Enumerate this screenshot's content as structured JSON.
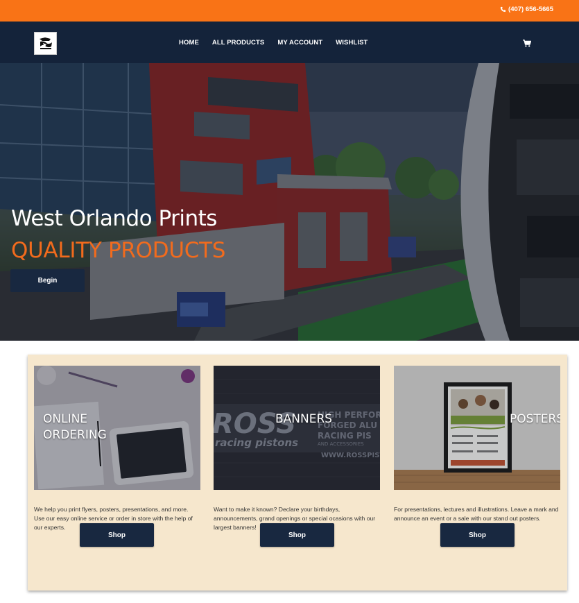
{
  "topbar": {
    "phone": "(407) 656-5665",
    "icon": "phone-icon"
  },
  "nav": {
    "items": [
      {
        "label": "HOME"
      },
      {
        "label": "ALL PRODUCTS"
      },
      {
        "label": "MY ACCOUNT"
      },
      {
        "label": "WISHLIST"
      }
    ],
    "cart_icon": "cart-icon"
  },
  "hero": {
    "title": "West Orlando Prints",
    "subtitle": "QUALITY PRODUCTS",
    "button": "Begin"
  },
  "products": [
    {
      "label_line1": "ONLINE",
      "label_line2": "ORDERING",
      "description": "We help you print flyers, posters, presentations, and more. Use our easy online service or order in store with the help of our experts.",
      "button": "Shop"
    },
    {
      "label_line1": "BANNERS",
      "label_line2": "",
      "description": "Want to make it known? Declare your birthdays, announcements, grand openings or special ocasions with our largest banners!",
      "button": "Shop",
      "image_text": [
        "ROSS",
        "racing pistons",
        "HIGH PERFOR",
        "FORGED ALU",
        "RACING PIS",
        "AND ACCESSORIES",
        "WWW.ROSSPIST"
      ]
    },
    {
      "label_line1": "POSTERS",
      "label_line2": "",
      "description": "For presentations, lectures and illustrations.  Leave a mark and announce an event or a sale with our stand out posters.",
      "button": "Shop"
    }
  ],
  "colors": {
    "orange": "#f97316",
    "navy": "#14233a",
    "button": "#182840",
    "accent": "#f26b1d",
    "panel": "#f6e7cd"
  }
}
